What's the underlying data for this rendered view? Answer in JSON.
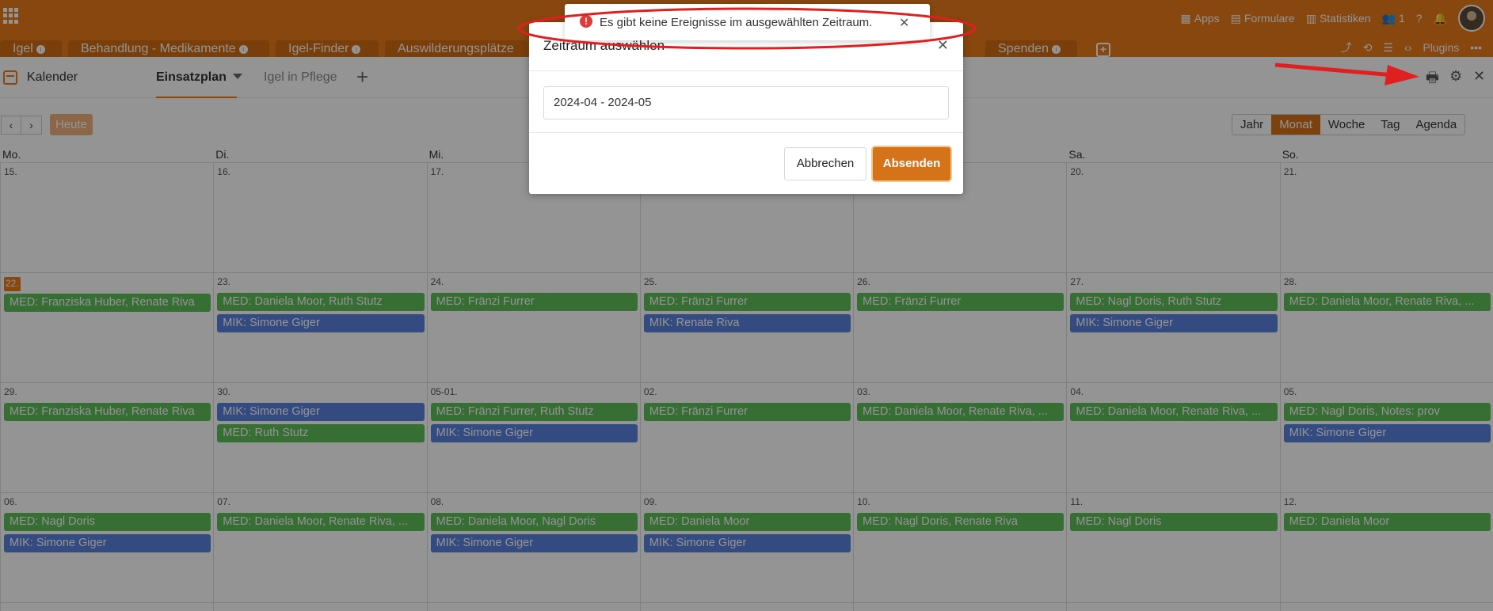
{
  "topbar": {
    "items": [
      {
        "icon": "apps-icon",
        "label": "Apps"
      },
      {
        "icon": "form-icon",
        "label": "Formulare"
      },
      {
        "icon": "chart-icon",
        "label": "Statistiken"
      },
      {
        "icon": "users-icon",
        "label": "1"
      }
    ]
  },
  "tables": [
    "Igel",
    "Behandlung - Medikamente",
    "Igel-Finder",
    "Auswilderungsplätze",
    "Spenden"
  ],
  "table_toolbar": {
    "plugins": "Plugins"
  },
  "view": {
    "title": "Kalender",
    "tabs": [
      {
        "label": "Einsatzplan",
        "active": true
      },
      {
        "label": "Igel in Pflege",
        "active": false
      }
    ]
  },
  "calendar": {
    "today_label": "Heute",
    "modes": [
      "Jahr",
      "Monat",
      "Woche",
      "Tag",
      "Agenda"
    ],
    "active_mode": "Monat",
    "weekdays": [
      "Mo.",
      "Di.",
      "Mi.",
      "",
      "",
      "Sa.",
      "So."
    ],
    "weeks": [
      {
        "days": [
          {
            "num": "15.",
            "events": []
          },
          {
            "num": "16.",
            "events": []
          },
          {
            "num": "17.",
            "events": []
          },
          {
            "num": "",
            "events": []
          },
          {
            "num": "",
            "events": []
          },
          {
            "num": "20.",
            "events": []
          },
          {
            "num": "21.",
            "events": []
          }
        ]
      },
      {
        "days": [
          {
            "num": "22.",
            "today": true,
            "events": [
              {
                "type": "med",
                "text": "MED: Franziska Huber, Renate Riva"
              }
            ]
          },
          {
            "num": "23.",
            "events": [
              {
                "type": "med",
                "text": "MED: Daniela Moor, Ruth Stutz"
              },
              {
                "type": "mik",
                "text": "MIK: Simone Giger"
              }
            ]
          },
          {
            "num": "24.",
            "events": [
              {
                "type": "med",
                "text": "MED: Fränzi Furrer"
              }
            ]
          },
          {
            "num": "25.",
            "events": [
              {
                "type": "med",
                "text": "MED: Fränzi Furrer"
              },
              {
                "type": "mik",
                "text": "MIK: Renate Riva"
              }
            ]
          },
          {
            "num": "26.",
            "events": [
              {
                "type": "med",
                "text": "MED: Fränzi Furrer"
              }
            ]
          },
          {
            "num": "27.",
            "events": [
              {
                "type": "med",
                "text": "MED: Nagl Doris, Ruth Stutz"
              },
              {
                "type": "mik",
                "text": "MIK: Simone Giger"
              }
            ]
          },
          {
            "num": "28.",
            "events": [
              {
                "type": "med",
                "text": "MED: Daniela Moor, Renate Riva, ..."
              }
            ]
          }
        ]
      },
      {
        "days": [
          {
            "num": "29.",
            "events": [
              {
                "type": "med",
                "text": "MED: Franziska Huber, Renate Riva"
              }
            ]
          },
          {
            "num": "30.",
            "events": [
              {
                "type": "mik",
                "text": "MIK: Simone Giger"
              },
              {
                "type": "med",
                "text": "MED: Ruth Stutz"
              }
            ]
          },
          {
            "num": "05-01.",
            "events": [
              {
                "type": "med",
                "text": "MED: Fränzi Furrer, Ruth Stutz"
              },
              {
                "type": "mik",
                "text": "MIK: Simone Giger"
              }
            ]
          },
          {
            "num": "02.",
            "events": [
              {
                "type": "med",
                "text": "MED: Fränzi Furrer"
              }
            ]
          },
          {
            "num": "03.",
            "events": [
              {
                "type": "med",
                "text": "MED: Daniela Moor, Renate Riva, ..."
              }
            ]
          },
          {
            "num": "04.",
            "events": [
              {
                "type": "med",
                "text": "MED: Daniela Moor, Renate Riva, ..."
              }
            ]
          },
          {
            "num": "05.",
            "events": [
              {
                "type": "med",
                "text": "MED: Nagl Doris, Notes: prov"
              },
              {
                "type": "mik",
                "text": "MIK: Simone Giger"
              }
            ]
          }
        ]
      },
      {
        "days": [
          {
            "num": "06.",
            "events": [
              {
                "type": "med",
                "text": "MED: Nagl Doris"
              },
              {
                "type": "mik",
                "text": "MIK: Simone Giger"
              }
            ]
          },
          {
            "num": "07.",
            "events": [
              {
                "type": "med",
                "text": "MED: Daniela Moor, Renate Riva, ..."
              }
            ]
          },
          {
            "num": "08.",
            "events": [
              {
                "type": "med",
                "text": "MED: Daniela Moor, Nagl Doris"
              },
              {
                "type": "mik",
                "text": "MIK: Simone Giger"
              }
            ]
          },
          {
            "num": "09.",
            "events": [
              {
                "type": "med",
                "text": "MED: Daniela Moor"
              },
              {
                "type": "mik",
                "text": "MIK: Simone Giger"
              }
            ]
          },
          {
            "num": "10.",
            "events": [
              {
                "type": "med",
                "text": "MED: Nagl Doris, Renate Riva"
              }
            ]
          },
          {
            "num": "11.",
            "events": [
              {
                "type": "med",
                "text": "MED: Nagl Doris"
              }
            ]
          },
          {
            "num": "12.",
            "events": [
              {
                "type": "med",
                "text": "MED: Daniela Moor"
              }
            ]
          }
        ]
      }
    ]
  },
  "modal": {
    "title": "Zeitraum auswählen",
    "range_value": "2024-04 - 2024-05",
    "cancel_label": "Abbrechen",
    "submit_label": "Absenden"
  },
  "toast": {
    "message": "Es gibt keine Ereignisse im ausgewählten Zeitraum."
  },
  "colors": {
    "brand": "#e87b1a",
    "med_event": "#5fbd5a",
    "mik_event": "#5a82e0",
    "annotation": "#e02020"
  }
}
